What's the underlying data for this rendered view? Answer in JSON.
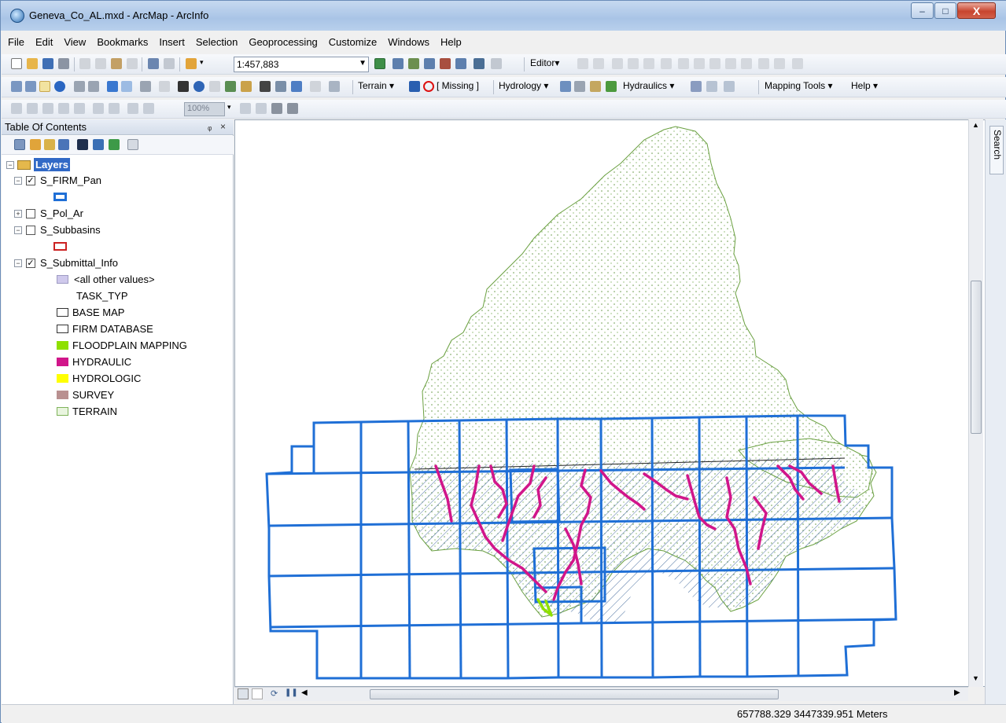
{
  "window": {
    "title": "Geneva_Co_AL.mxd - ArcMap - ArcInfo",
    "minimize": "–",
    "maximize": "□",
    "close": "X"
  },
  "menu": [
    "File",
    "Edit",
    "View",
    "Bookmarks",
    "Insert",
    "Selection",
    "Geoprocessing",
    "Customize",
    "Windows",
    "Help"
  ],
  "toolbar1": {
    "scale": "1:457,883",
    "editor": "Editor▾"
  },
  "toolbar2": {
    "terrain": "Terrain ▾",
    "missing": "[ Missing ]",
    "hydrology": "Hydrology ▾",
    "hydraulics": "Hydraulics ▾",
    "mapping_tools": "Mapping Tools ▾",
    "help": "Help ▾"
  },
  "toolbar3": {
    "zoom_percent": "100%"
  },
  "toc": {
    "title": "Table Of Contents",
    "pin": "ᵩ",
    "close": "×",
    "root": "Layers",
    "layers": [
      {
        "name": "S_FIRM_Pan",
        "checked": true,
        "expanded": true
      },
      {
        "name": "S_Pol_Ar",
        "checked": false,
        "expanded": false
      },
      {
        "name": "S_Subbasins",
        "checked": false,
        "expanded": true
      },
      {
        "name": "S_Submittal_Info",
        "checked": true,
        "expanded": true
      }
    ],
    "legend": {
      "all_other": "<all other values>",
      "field": "TASK_TYP",
      "items": [
        "BASE MAP",
        "FIRM DATABASE",
        "FLOODPLAIN MAPPING",
        "HYDRAULIC",
        "HYDROLOGIC",
        "SURVEY",
        "TERRAIN"
      ]
    }
  },
  "colors": {
    "firm_panel_outline": "#1f6fd6",
    "subbasin_outline": "#cc2222",
    "all_other": "#cfc9ec",
    "floodplain": "#8fe000",
    "hydraulic": "#d1168a",
    "hydrologic": "#ffff00",
    "survey": "#b99090",
    "terrain": "#7fb35a"
  },
  "search_tab": "Search",
  "status": {
    "coordinates": "657788.329  3447339.951 Meters"
  }
}
